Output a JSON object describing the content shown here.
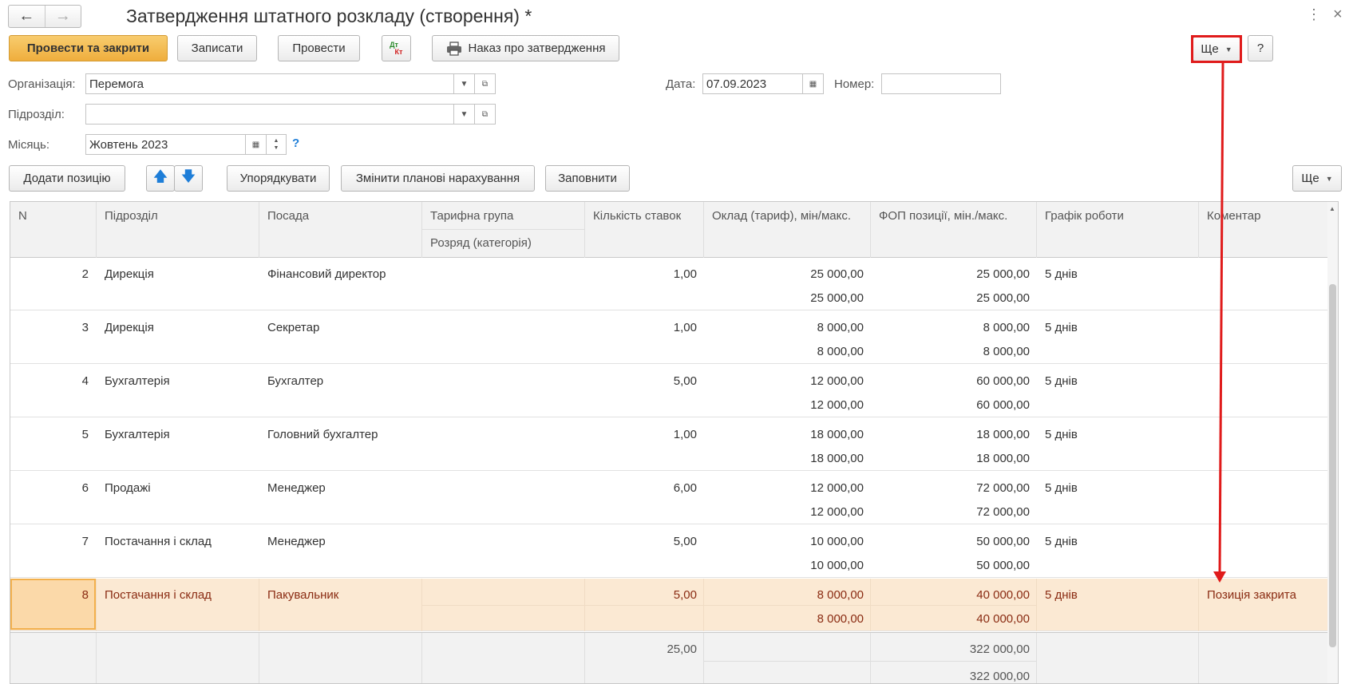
{
  "window": {
    "title": "Затвердження штатного розкладу (створення) *",
    "more_dots": "⋮",
    "close": "×"
  },
  "toolbar": {
    "post_close": "Провести та закрити",
    "save": "Записати",
    "post": "Провести",
    "dtkt_top": "Дт",
    "dtkt_bottom": "Кт",
    "order": "Наказ про затвердження",
    "more": "Ще",
    "help": "?"
  },
  "form": {
    "org_label": "Організація:",
    "org_value": "Перемога",
    "dept_label": "Підрозділ:",
    "dept_value": "",
    "month_label": "Місяць:",
    "month_value": "Жовтень 2023",
    "month_help": "?",
    "date_label": "Дата:",
    "date_value": "07.09.2023",
    "number_label": "Номер:",
    "number_value": ""
  },
  "table_toolbar": {
    "add": "Додати позицію",
    "sort": "Упорядкувати",
    "change": "Змінити планові нарахування",
    "fill": "Заповнити",
    "more": "Ще"
  },
  "columns": {
    "n": "N",
    "dept": "Підрозділ",
    "position": "Посада",
    "tariff_group": "Тарифна група",
    "rank": "Розряд (категорія)",
    "rates": "Кількість ставок",
    "salary": "Оклад (тариф), мін/макс.",
    "fund": "ФОП позиції, мін./макс.",
    "schedule": "Графік роботи",
    "comment": "Коментар"
  },
  "rows": [
    {
      "n": "2",
      "dept": "Дирекція",
      "position": "Фінансовий директор",
      "rates": "1,00",
      "salary_min": "25 000,00",
      "salary_max": "25 000,00",
      "fund_min": "25 000,00",
      "fund_max": "25 000,00",
      "schedule": "5 днів",
      "comment": ""
    },
    {
      "n": "3",
      "dept": "Дирекція",
      "position": "Секретар",
      "rates": "1,00",
      "salary_min": "8 000,00",
      "salary_max": "8 000,00",
      "fund_min": "8 000,00",
      "fund_max": "8 000,00",
      "schedule": "5 днів",
      "comment": ""
    },
    {
      "n": "4",
      "dept": "Бухгалтерія",
      "position": "Бухгалтер",
      "rates": "5,00",
      "salary_min": "12 000,00",
      "salary_max": "12 000,00",
      "fund_min": "60 000,00",
      "fund_max": "60 000,00",
      "schedule": "5 днів",
      "comment": ""
    },
    {
      "n": "5",
      "dept": "Бухгалтерія",
      "position": "Головний бухгалтер",
      "rates": "1,00",
      "salary_min": "18 000,00",
      "salary_max": "18 000,00",
      "fund_min": "18 000,00",
      "fund_max": "18 000,00",
      "schedule": "5 днів",
      "comment": ""
    },
    {
      "n": "6",
      "dept": "Продажі",
      "position": "Менеджер",
      "rates": "6,00",
      "salary_min": "12 000,00",
      "salary_max": "12 000,00",
      "fund_min": "72 000,00",
      "fund_max": "72 000,00",
      "schedule": "5 днів",
      "comment": ""
    },
    {
      "n": "7",
      "dept": "Постачання і склад",
      "position": "Менеджер",
      "rates": "5,00",
      "salary_min": "10 000,00",
      "salary_max": "10 000,00",
      "fund_min": "50 000,00",
      "fund_max": "50 000,00",
      "schedule": "5 днів",
      "comment": ""
    },
    {
      "n": "8",
      "dept": "Постачання і склад",
      "position": "Пакувальник",
      "rates": "5,00",
      "salary_min": "8 000,00",
      "salary_max": "8 000,00",
      "fund_min": "40 000,00",
      "fund_max": "40 000,00",
      "schedule": "5 днів",
      "comment": "Позиція закрита"
    }
  ],
  "totals": {
    "rates": "25,00",
    "fund_min": "322 000,00",
    "fund_max": "322 000,00"
  },
  "colors": {
    "primary_button": "#f0b040",
    "selected_row": "#fbe9d3",
    "selected_text": "#8a2b12",
    "annotation": "#e01b1b",
    "arrow_icon": "#1e7ed8"
  }
}
